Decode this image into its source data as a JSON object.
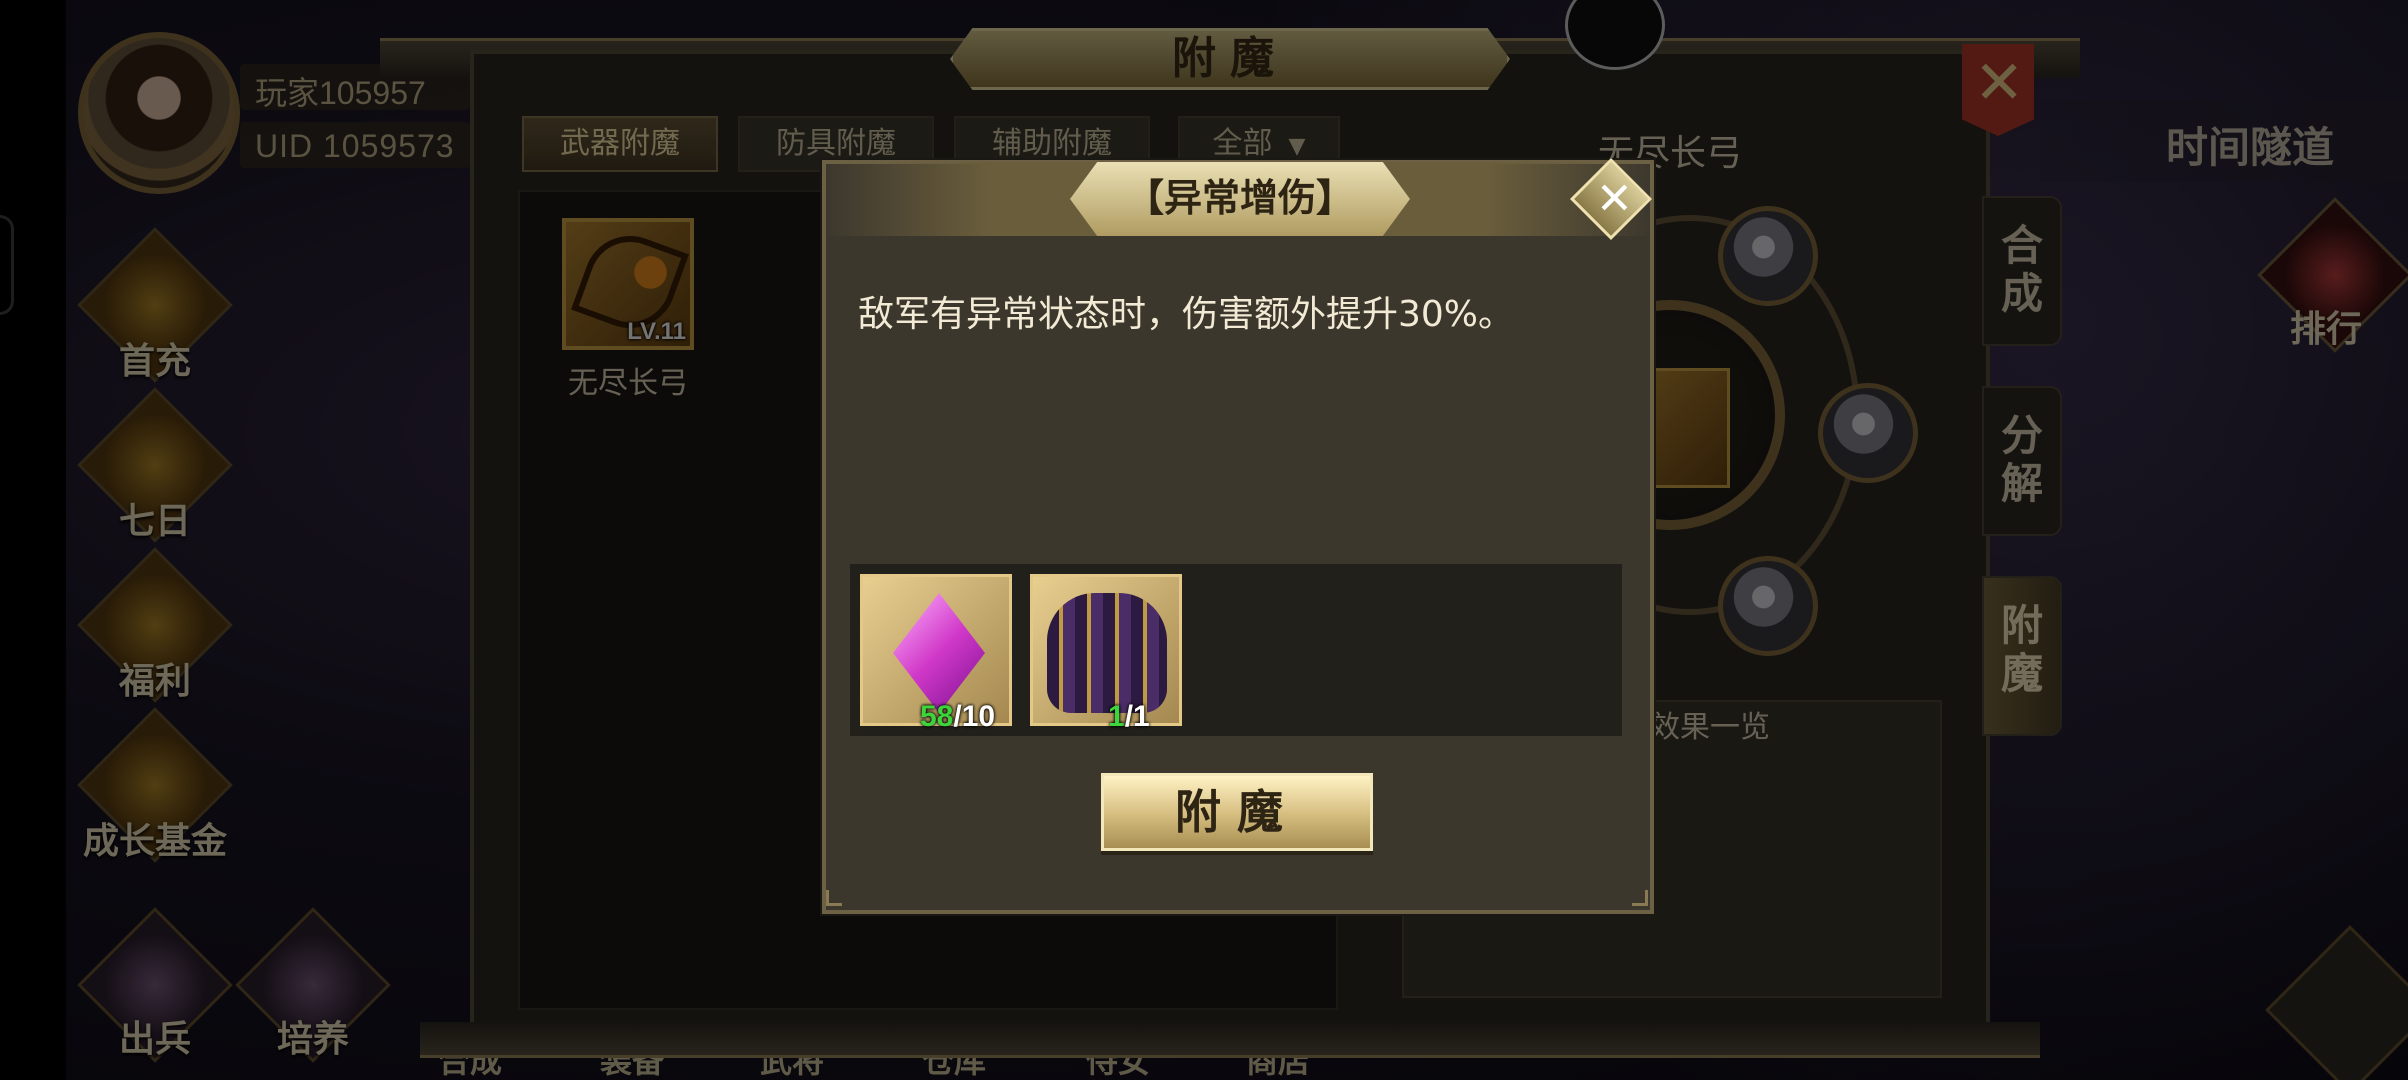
{
  "player": {
    "name": "玩家105957",
    "uid": "UID  1059573"
  },
  "side_menu": [
    "首充",
    "七日",
    "福利",
    "成长基金"
  ],
  "bottom_menu": [
    "出兵",
    "培养"
  ],
  "bottom_text": [
    "合成",
    "装备",
    "武将",
    "仓库",
    "侍女",
    "商店"
  ],
  "right_hud": {
    "tunnel": "时间隧道",
    "rank": "排行"
  },
  "panel": {
    "title": "附魔",
    "tabs": [
      "武器附魔",
      "防具附魔",
      "辅助附魔"
    ],
    "filter": {
      "label": "全部",
      "caret": "▼"
    },
    "item": {
      "name": "无尽长弓",
      "level": "LV.11"
    },
    "right_title": "无尽长弓",
    "effect_title": "效果一览",
    "side_tabs": [
      "合成",
      "分解",
      "附魔"
    ],
    "close_icon": "✕"
  },
  "popup": {
    "title": "【异常增伤】",
    "close_icon": "✕",
    "description": "敌军有异常状态时，伤害额外提升30%。",
    "materials": [
      {
        "icon": "pink-gem-icon",
        "have": "58",
        "need": "/10"
      },
      {
        "icon": "armor-icon",
        "have": "1",
        "need": "/1"
      }
    ],
    "confirm_label": "附魔"
  },
  "colors": {
    "have_ok": "#3cd63c",
    "gold": "#d4bc7e",
    "close_red": "#b83a2a"
  }
}
